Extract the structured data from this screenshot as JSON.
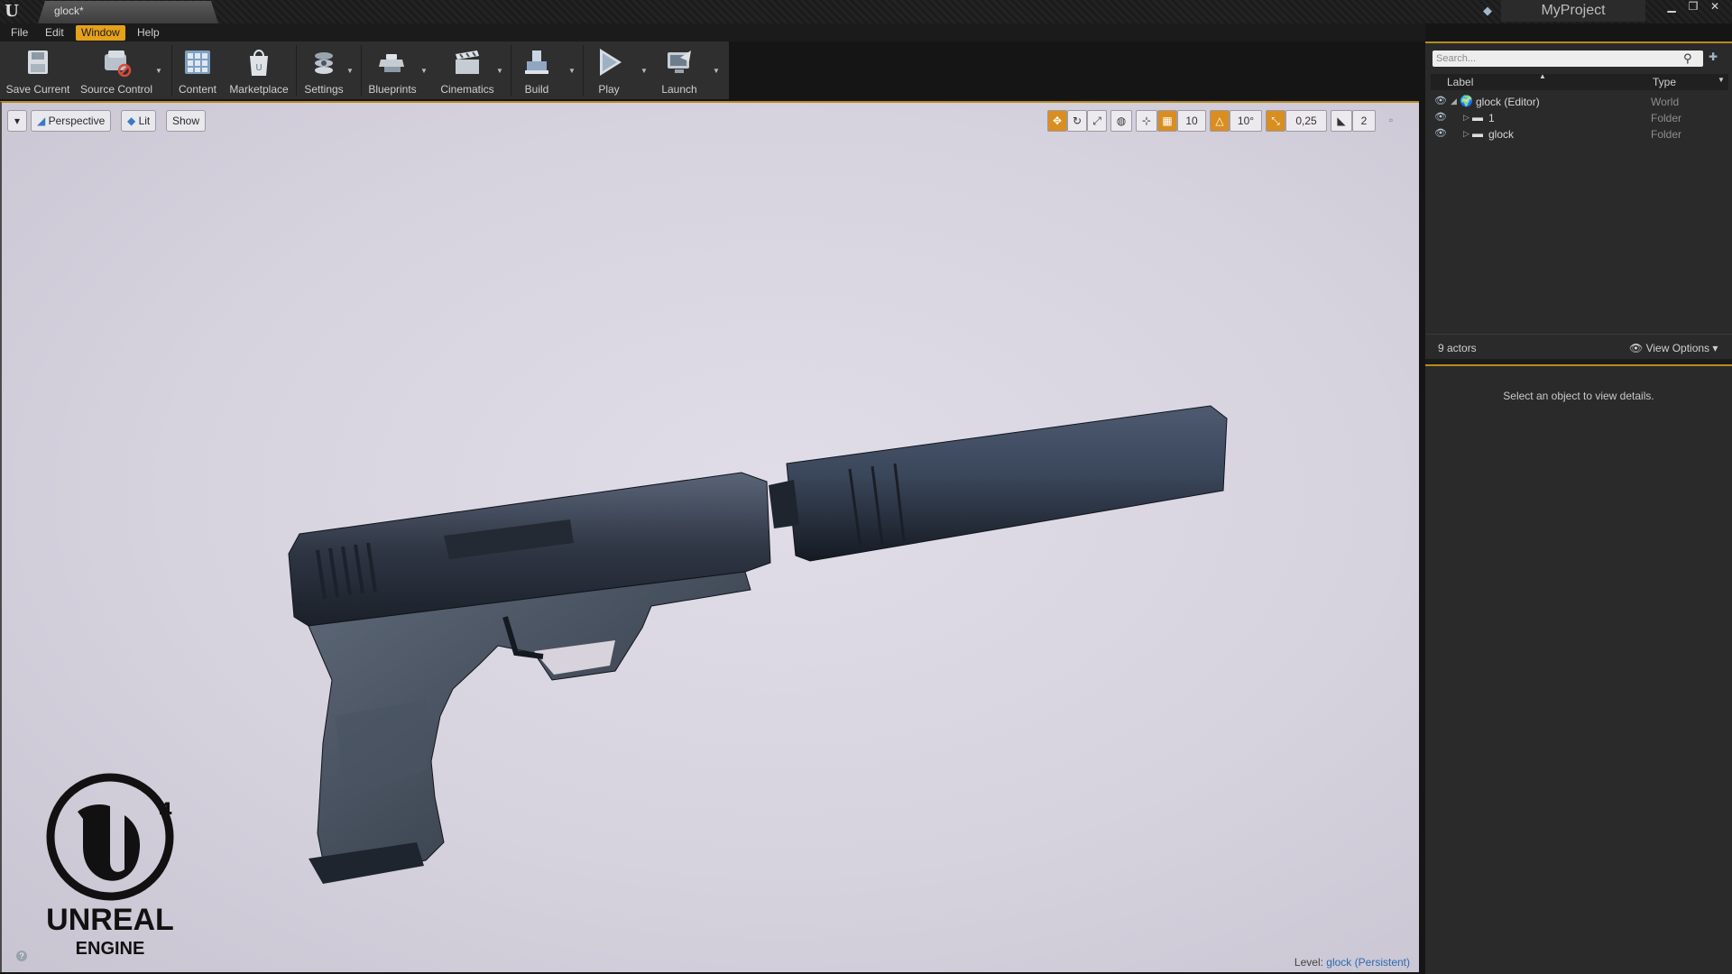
{
  "window": {
    "tab_title": "glock*",
    "project_name": "MyProject",
    "minimize": "▁",
    "restore": "❐",
    "close": "✕"
  },
  "menu": [
    "File",
    "Edit",
    "Window",
    "Help"
  ],
  "active_menu": "Window",
  "toolbar": [
    {
      "label": "Save Current",
      "icon": "save-icon"
    },
    {
      "label": "Source Control",
      "icon": "source-control-icon"
    },
    {
      "label": "Content",
      "icon": "content-icon"
    },
    {
      "label": "Marketplace",
      "icon": "marketplace-icon"
    },
    {
      "label": "Settings",
      "icon": "settings-icon"
    },
    {
      "label": "Blueprints",
      "icon": "blueprints-icon"
    },
    {
      "label": "Cinematics",
      "icon": "cinematics-icon"
    },
    {
      "label": "Build",
      "icon": "build-icon"
    },
    {
      "label": "Play",
      "icon": "play-icon"
    },
    {
      "label": "Launch",
      "icon": "launch-icon"
    }
  ],
  "viewport": {
    "view_mode": "Perspective",
    "lighting": "Lit",
    "show": "Show",
    "grid_snap": "10",
    "rotation_snap": "10°",
    "scale_snap": "0,25",
    "camera_speed": "2",
    "level_prefix": "Level:",
    "level_name": "glock (Persistent)",
    "logo_text_1": "UNREAL",
    "logo_text_2": "ENGINE"
  },
  "outliner": {
    "search_placeholder": "Search...",
    "col_label": "Label",
    "col_type": "Type",
    "rows": [
      {
        "label": "glock (Editor)",
        "type": "World",
        "icon": "world-icon"
      },
      {
        "label": "1",
        "type": "Folder",
        "icon": "folder-icon"
      },
      {
        "label": "glock",
        "type": "Folder",
        "icon": "folder-icon"
      }
    ],
    "actor_count": "9 actors",
    "view_options": "View Options"
  },
  "details": {
    "message": "Select an object to view details."
  },
  "colors": {
    "accent": "#e5a11a",
    "panel": "#2a2a2a",
    "viewport_bg": "#d6d2de"
  }
}
